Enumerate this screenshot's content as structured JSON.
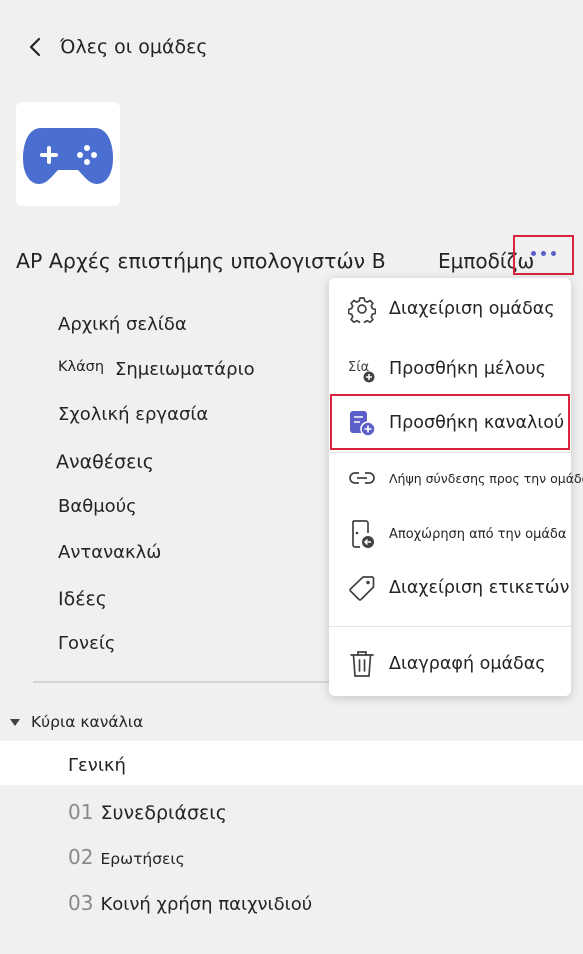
{
  "header": {
    "back_label": "Όλες οι ομάδες"
  },
  "team": {
    "name": "ΑΡ Αρχές επιστήμης υπολογιστών Β",
    "embed_label": "Εμποδίζω",
    "logo_icon": "gamepad-icon",
    "logo_color": "#4a6fd0"
  },
  "nav": {
    "items": [
      "Αρχική σελίδα",
      "Κλάση",
      "Σημειωματάριο",
      "Σχολική εργασία",
      "Αναθέσεις",
      "Βαθμούς",
      "Αντανακλώ",
      "Ιδέες",
      "Γονείς"
    ]
  },
  "channels": {
    "header": "Κύρια κανάλια",
    "general": "Γενική",
    "items": [
      {
        "num": "01",
        "label": "Συνεδριάσεις"
      },
      {
        "num": "02",
        "label": "Ερωτήσεις"
      },
      {
        "num": "03",
        "label": "Κοινή χρήση παιχνιδιού"
      }
    ]
  },
  "menu": {
    "items": [
      {
        "label": "Διαχείριση ομάδας",
        "icon": "gear-icon"
      },
      {
        "label": "Προσθήκη μέλους",
        "icon": "add-person-icon",
        "icon_text": "Σία"
      },
      {
        "label": "Προσθήκη καναλιού",
        "icon": "add-channel-icon"
      },
      {
        "label": "Λήψη σύνδεσης προς την ομάδα",
        "icon": "link-icon"
      },
      {
        "label": "Αποχώρηση από την ομάδα",
        "icon": "leave-icon"
      },
      {
        "label": "Διαχείριση ετικετών",
        "icon": "tag-icon"
      },
      {
        "label": "Διαγραφή ομάδας",
        "icon": "trash-icon"
      }
    ]
  },
  "colors": {
    "accent": "#5b5fc7",
    "highlight_border": "#d7243c"
  }
}
